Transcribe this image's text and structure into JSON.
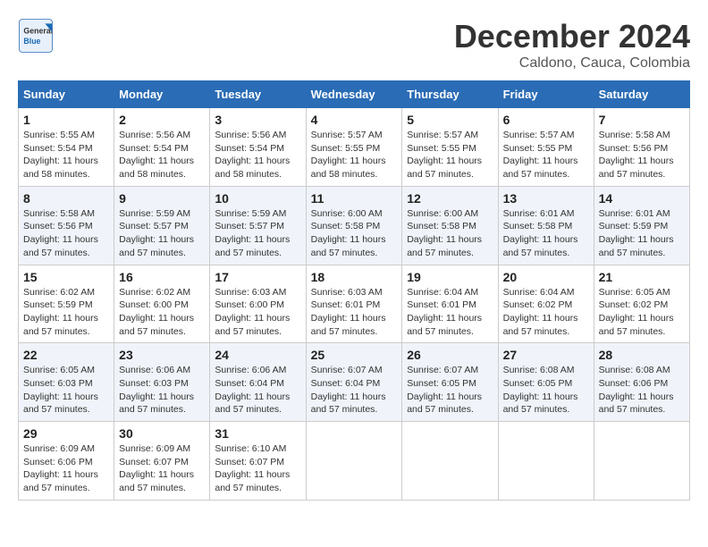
{
  "header": {
    "logo_general": "General",
    "logo_blue": "Blue",
    "month_title": "December 2024",
    "subtitle": "Caldono, Cauca, Colombia"
  },
  "calendar": {
    "days_of_week": [
      "Sunday",
      "Monday",
      "Tuesday",
      "Wednesday",
      "Thursday",
      "Friday",
      "Saturday"
    ],
    "weeks": [
      [
        {
          "day": "1",
          "sunrise": "5:55 AM",
          "sunset": "5:54 PM",
          "daylight": "11 hours and 58 minutes."
        },
        {
          "day": "2",
          "sunrise": "5:56 AM",
          "sunset": "5:54 PM",
          "daylight": "11 hours and 58 minutes."
        },
        {
          "day": "3",
          "sunrise": "5:56 AM",
          "sunset": "5:54 PM",
          "daylight": "11 hours and 58 minutes."
        },
        {
          "day": "4",
          "sunrise": "5:57 AM",
          "sunset": "5:55 PM",
          "daylight": "11 hours and 58 minutes."
        },
        {
          "day": "5",
          "sunrise": "5:57 AM",
          "sunset": "5:55 PM",
          "daylight": "11 hours and 57 minutes."
        },
        {
          "day": "6",
          "sunrise": "5:57 AM",
          "sunset": "5:55 PM",
          "daylight": "11 hours and 57 minutes."
        },
        {
          "day": "7",
          "sunrise": "5:58 AM",
          "sunset": "5:56 PM",
          "daylight": "11 hours and 57 minutes."
        }
      ],
      [
        {
          "day": "8",
          "sunrise": "5:58 AM",
          "sunset": "5:56 PM",
          "daylight": "11 hours and 57 minutes."
        },
        {
          "day": "9",
          "sunrise": "5:59 AM",
          "sunset": "5:57 PM",
          "daylight": "11 hours and 57 minutes."
        },
        {
          "day": "10",
          "sunrise": "5:59 AM",
          "sunset": "5:57 PM",
          "daylight": "11 hours and 57 minutes."
        },
        {
          "day": "11",
          "sunrise": "6:00 AM",
          "sunset": "5:58 PM",
          "daylight": "11 hours and 57 minutes."
        },
        {
          "day": "12",
          "sunrise": "6:00 AM",
          "sunset": "5:58 PM",
          "daylight": "11 hours and 57 minutes."
        },
        {
          "day": "13",
          "sunrise": "6:01 AM",
          "sunset": "5:58 PM",
          "daylight": "11 hours and 57 minutes."
        },
        {
          "day": "14",
          "sunrise": "6:01 AM",
          "sunset": "5:59 PM",
          "daylight": "11 hours and 57 minutes."
        }
      ],
      [
        {
          "day": "15",
          "sunrise": "6:02 AM",
          "sunset": "5:59 PM",
          "daylight": "11 hours and 57 minutes."
        },
        {
          "day": "16",
          "sunrise": "6:02 AM",
          "sunset": "6:00 PM",
          "daylight": "11 hours and 57 minutes."
        },
        {
          "day": "17",
          "sunrise": "6:03 AM",
          "sunset": "6:00 PM",
          "daylight": "11 hours and 57 minutes."
        },
        {
          "day": "18",
          "sunrise": "6:03 AM",
          "sunset": "6:01 PM",
          "daylight": "11 hours and 57 minutes."
        },
        {
          "day": "19",
          "sunrise": "6:04 AM",
          "sunset": "6:01 PM",
          "daylight": "11 hours and 57 minutes."
        },
        {
          "day": "20",
          "sunrise": "6:04 AM",
          "sunset": "6:02 PM",
          "daylight": "11 hours and 57 minutes."
        },
        {
          "day": "21",
          "sunrise": "6:05 AM",
          "sunset": "6:02 PM",
          "daylight": "11 hours and 57 minutes."
        }
      ],
      [
        {
          "day": "22",
          "sunrise": "6:05 AM",
          "sunset": "6:03 PM",
          "daylight": "11 hours and 57 minutes."
        },
        {
          "day": "23",
          "sunrise": "6:06 AM",
          "sunset": "6:03 PM",
          "daylight": "11 hours and 57 minutes."
        },
        {
          "day": "24",
          "sunrise": "6:06 AM",
          "sunset": "6:04 PM",
          "daylight": "11 hours and 57 minutes."
        },
        {
          "day": "25",
          "sunrise": "6:07 AM",
          "sunset": "6:04 PM",
          "daylight": "11 hours and 57 minutes."
        },
        {
          "day": "26",
          "sunrise": "6:07 AM",
          "sunset": "6:05 PM",
          "daylight": "11 hours and 57 minutes."
        },
        {
          "day": "27",
          "sunrise": "6:08 AM",
          "sunset": "6:05 PM",
          "daylight": "11 hours and 57 minutes."
        },
        {
          "day": "28",
          "sunrise": "6:08 AM",
          "sunset": "6:06 PM",
          "daylight": "11 hours and 57 minutes."
        }
      ],
      [
        {
          "day": "29",
          "sunrise": "6:09 AM",
          "sunset": "6:06 PM",
          "daylight": "11 hours and 57 minutes."
        },
        {
          "day": "30",
          "sunrise": "6:09 AM",
          "sunset": "6:07 PM",
          "daylight": "11 hours and 57 minutes."
        },
        {
          "day": "31",
          "sunrise": "6:10 AM",
          "sunset": "6:07 PM",
          "daylight": "11 hours and 57 minutes."
        },
        null,
        null,
        null,
        null
      ]
    ],
    "labels": {
      "sunrise": "Sunrise: ",
      "sunset": "Sunset: ",
      "daylight": "Daylight: "
    }
  }
}
